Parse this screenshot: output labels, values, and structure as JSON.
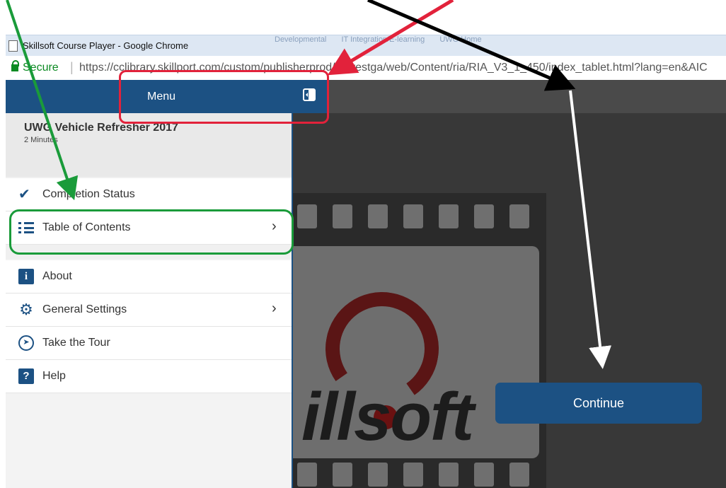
{
  "window": {
    "title": "Skillsoft Course Player - Google Chrome",
    "background_tabs": [
      "Developmental",
      "IT Integration/E-learning",
      "UWG Home"
    ]
  },
  "address_bar": {
    "secure_label": "Secure",
    "url": "https://cclibrary.skillport.com/custom/publisherprod/spwestga/web/Content/ria/RIA_V3_1_450/index_tablet.html?lang=en&AIC"
  },
  "menu": {
    "title": "Menu",
    "course_title": "UWG Vehicle Refresher 2017",
    "course_duration": "2 Minutes",
    "items": [
      {
        "label": "Completion Status",
        "icon": "completion-status-icon",
        "has_submenu": false
      },
      {
        "label": "Table of Contents",
        "icon": "list-icon",
        "has_submenu": true
      },
      {
        "label": "About",
        "icon": "info-icon",
        "has_submenu": false
      },
      {
        "label": "General Settings",
        "icon": "gear-icon",
        "has_submenu": true
      },
      {
        "label": "Take the Tour",
        "icon": "compass-icon",
        "has_submenu": false
      },
      {
        "label": "Help",
        "icon": "help-icon",
        "has_submenu": false
      }
    ],
    "chevron": "›",
    "info_glyph": "i",
    "help_glyph": "?"
  },
  "content": {
    "logo_text": "illsoft",
    "continue_label": "Continue"
  },
  "colors": {
    "brand_blue": "#1c5183",
    "annotation_red": "#e2223b",
    "annotation_green": "#1a9b3a",
    "annotation_black": "#000000",
    "annotation_white": "#ffffff"
  }
}
